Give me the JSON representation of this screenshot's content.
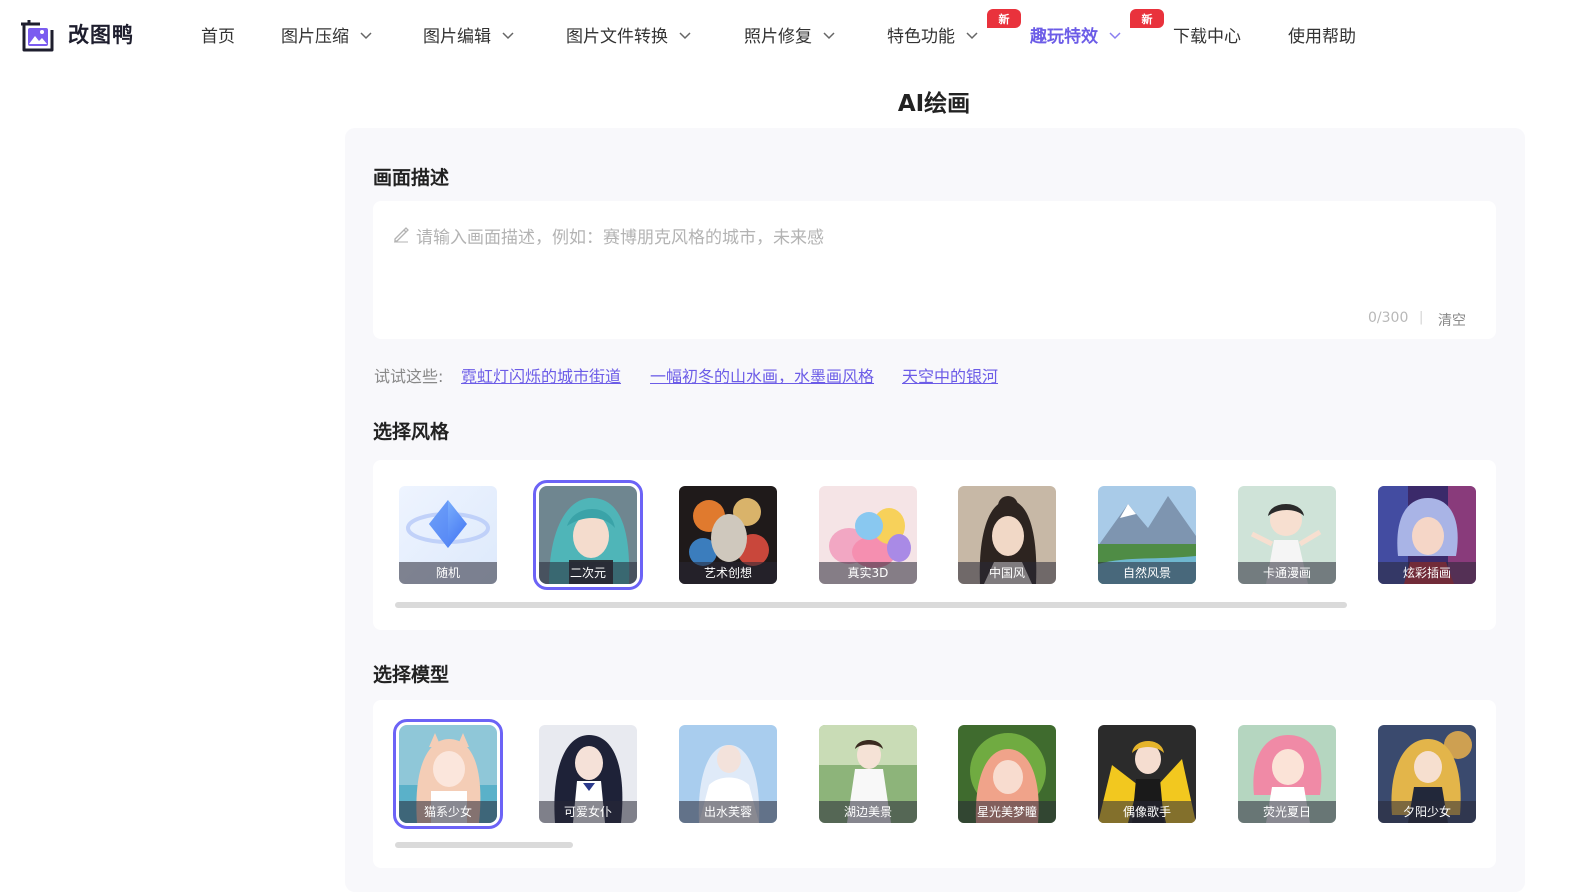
{
  "app": {
    "name": "改图鸭",
    "page_title": "AI绘画"
  },
  "nav": {
    "items": [
      {
        "label": "首页",
        "has_dropdown": false
      },
      {
        "label": "图片压缩",
        "has_dropdown": true
      },
      {
        "label": "图片编辑",
        "has_dropdown": true
      },
      {
        "label": "图片文件转换",
        "has_dropdown": true
      },
      {
        "label": "照片修复",
        "has_dropdown": true
      },
      {
        "label": "特色功能",
        "has_dropdown": true,
        "badge": "新"
      },
      {
        "label": "趣玩特效",
        "has_dropdown": true,
        "badge": "新",
        "active": true
      },
      {
        "label": "下载中心",
        "has_dropdown": false
      },
      {
        "label": "使用帮助",
        "has_dropdown": false
      }
    ]
  },
  "description": {
    "title": "画面描述",
    "placeholder": "请输入画面描述，例如：赛博朋克风格的城市，未来感",
    "value": "",
    "counter": "0/300",
    "separator": "|",
    "clear_label": "清空"
  },
  "suggestions": {
    "label": "试试这些:",
    "items": [
      "霓虹灯闪烁的城市街道",
      "一幅初冬的山水画，水墨画风格",
      "天空中的银河"
    ]
  },
  "styles": {
    "title": "选择风格",
    "selected": "二次元",
    "items": [
      "随机",
      "二次元",
      "艺术创想",
      "真实3D",
      "中国风",
      "自然风景",
      "卡通漫画",
      "炫彩插画"
    ]
  },
  "models": {
    "title": "选择模型",
    "selected": "猫系少女",
    "items": [
      "猫系少女",
      "可爱女仆",
      "出水芙蓉",
      "湖边美景",
      "星光美梦瞳",
      "偶像歌手",
      "荧光夏日",
      "夕阳少女"
    ]
  },
  "colors": {
    "accent": "#6c5ce7",
    "badge": "#e9323c",
    "panel_bg": "#f8f8fb",
    "link": "#6c5ce7"
  }
}
